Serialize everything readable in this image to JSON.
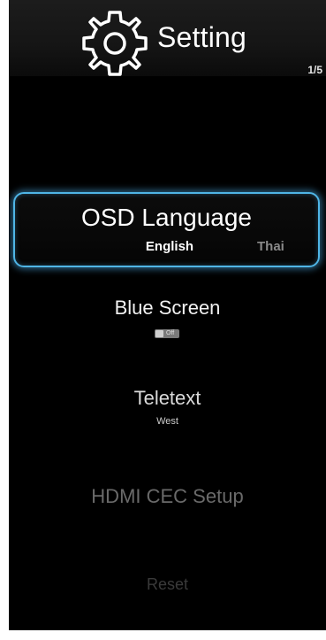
{
  "header": {
    "title": "Setting",
    "page_indicator": "1/5",
    "icon": "gear-icon"
  },
  "menu": {
    "osd_language": {
      "label": "OSD Language",
      "options": [
        "English",
        "Thai"
      ],
      "selected": "English"
    },
    "blue_screen": {
      "label": "Blue Screen",
      "toggle_state": "Off"
    },
    "teletext": {
      "label": "Teletext",
      "value": "West"
    },
    "hdmi_cec": {
      "label": "HDMI CEC Setup"
    },
    "reset": {
      "label": "Reset"
    }
  },
  "colors": {
    "background": "#000000",
    "focus_border": "#4fb5e6",
    "text": "#ffffff",
    "dimmed_text": "#6a6a6a"
  }
}
